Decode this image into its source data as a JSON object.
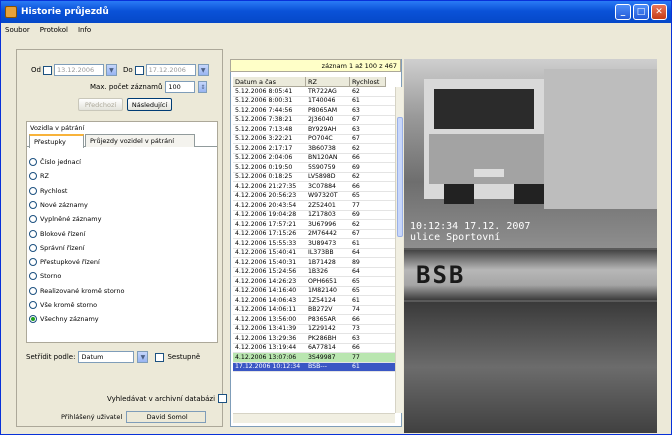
{
  "window": {
    "title": "Historie průjezdů"
  },
  "menu": [
    "Soubor",
    "Protokol",
    "Info"
  ],
  "filters": {
    "from_label": "Od",
    "from_value": "13.12.2006",
    "to_label": "Do",
    "to_value": "17.12.2006",
    "max_label": "Max. počet záznamů",
    "max_value": "100",
    "prev_button": "Předchozí",
    "next_button": "Následující"
  },
  "group": {
    "title": "Vozidla v pátrání",
    "tabs": [
      "Přestupky",
      "Průjezdy vozidel v pátrání"
    ],
    "options": [
      "Číslo jednací",
      "RZ",
      "Rychlost",
      "Nové záznamy",
      "Vyplněné záznamy",
      "Blokové řízení",
      "Správní řízení",
      "Přestupkové řízení",
      "Storno",
      "Realizované kromě storno",
      "Vše kromě storno",
      "Všechny záznamy"
    ],
    "selected_option": "Všechny záznamy"
  },
  "sort": {
    "label": "Setřídit podle:",
    "value": "Datum",
    "desc_label": "Sestupně"
  },
  "archive": {
    "label": "Vyhledávat v archivní databázi"
  },
  "user": {
    "label": "Přihlášený uživatel",
    "value": "David Somol"
  },
  "table": {
    "banner": "záznam 1 až 100 z 467",
    "columns": [
      "Datum a čas",
      "RZ",
      "Rychlost"
    ],
    "rows": [
      [
        "5.12.2006 8:05:41",
        "TR722AG",
        "62"
      ],
      [
        "5.12.2006 8:00:31",
        "1T40046",
        "61"
      ],
      [
        "5.12.2006 7:44:56",
        "P8065AM",
        "63"
      ],
      [
        "5.12.2006 7:38:21",
        "2J36040",
        "67"
      ],
      [
        "5.12.2006 7:13:48",
        "BY929AH",
        "63"
      ],
      [
        "5.12.2006 3:22:21",
        "PO704C",
        "67"
      ],
      [
        "5.12.2006 2:17:17",
        "3B60738",
        "62"
      ],
      [
        "5.12.2006 2:04:06",
        "BN120AN",
        "66"
      ],
      [
        "5.12.2006 0:19:50",
        "5S90759",
        "69"
      ],
      [
        "5.12.2006 0:18:25",
        "LV5898D",
        "62"
      ],
      [
        "4.12.2006 21:27:35",
        "3C07884",
        "66"
      ],
      [
        "4.12.2006 20:56:23",
        "W97320T",
        "65"
      ],
      [
        "4.12.2006 20:43:54",
        "2Z52401",
        "77"
      ],
      [
        "4.12.2006 19:04:28",
        "1Z17803",
        "69"
      ],
      [
        "4.12.2006 17:57:21",
        "3U67996",
        "62"
      ],
      [
        "4.12.2006 17:15:26",
        "2M76442",
        "67"
      ],
      [
        "4.12.2006 15:55:33",
        "3U89473",
        "61"
      ],
      [
        "4.12.2006 15:40:41",
        "IL373BB",
        "64"
      ],
      [
        "4.12.2006 15:40:31",
        "1B71428",
        "89"
      ],
      [
        "4.12.2006 15:24:56",
        "1B326",
        "64"
      ],
      [
        "4.12.2006 14:26:23",
        "OPH6651",
        "65"
      ],
      [
        "4.12.2006 14:16:40",
        "1M82140",
        "65"
      ],
      [
        "4.12.2006 14:06:43",
        "1Z54124",
        "61"
      ],
      [
        "4.12.2006 14:06:11",
        "BB272V",
        "74"
      ],
      [
        "4.12.2006 13:56:00",
        "P8365AR",
        "66"
      ],
      [
        "4.12.2006 13:41:39",
        "1Z29142",
        "73"
      ],
      [
        "4.12.2006 13:29:36",
        "PK286BH",
        "63"
      ],
      [
        "4.12.2006 13:19:44",
        "6A77814",
        "66"
      ],
      [
        "4.12.2006 13:07:06",
        "3S49987",
        "77"
      ],
      [
        "17.12.2006 10:12:34",
        "BSB---",
        "61"
      ]
    ]
  },
  "photo": {
    "timestamp": "10:12:34 17.12. 2007",
    "location": "ulice Sportovní",
    "plate_text": "BSB"
  }
}
